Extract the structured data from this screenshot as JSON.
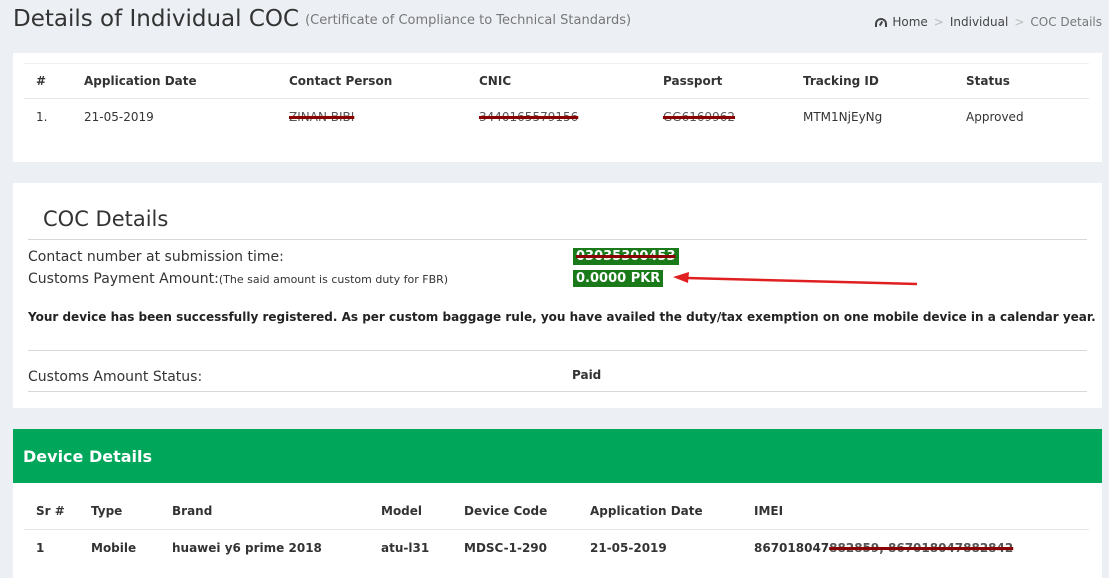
{
  "header": {
    "title": "Details of Individual COC",
    "subtitle": "(Certificate of Compliance to Technical Standards)",
    "breadcrumb": [
      "Home",
      "Individual",
      "COC Details"
    ]
  },
  "applications": {
    "columns": [
      "#",
      "Application Date",
      "Contact Person",
      "CNIC",
      "Passport",
      "Tracking ID",
      "Status"
    ],
    "rows": [
      [
        "1.",
        "21-05-2019",
        "ZINAN BIBI",
        "3440165579156",
        "GG6169962",
        "MTM1NjEyNg",
        "Approved"
      ]
    ]
  },
  "coc": {
    "title": "COC Details",
    "contact_label": "Contact number at submission time:",
    "contact_value": "03035300453",
    "payment_label": "Customs Payment Amount:",
    "payment_note": "(The said amount is custom duty for FBR)",
    "payment_value": "0.0000 PKR",
    "message": "Your device has been successfully registered. As per custom baggage rule, you have availed the duty/tax exemption on one mobile device in a calendar year.",
    "status_label": "Customs Amount Status:",
    "status_value": "Paid",
    "arrow_color": "#e02020"
  },
  "devices": {
    "title": "Device Details",
    "header_color": "#00a65a",
    "columns": [
      "Sr #",
      "Type",
      "Brand",
      "Model",
      "Device Code",
      "Application Date",
      "IMEI"
    ],
    "rows": [
      {
        "sr": "1",
        "type": "Mobile",
        "brand": "huawei y6 prime 2018",
        "model": "atu-l31",
        "device_code": "MDSC-1-290",
        "date": "21-05-2019",
        "imei_visible": "867018047",
        "imei_redacted": "882859, 867018047882842"
      }
    ]
  }
}
